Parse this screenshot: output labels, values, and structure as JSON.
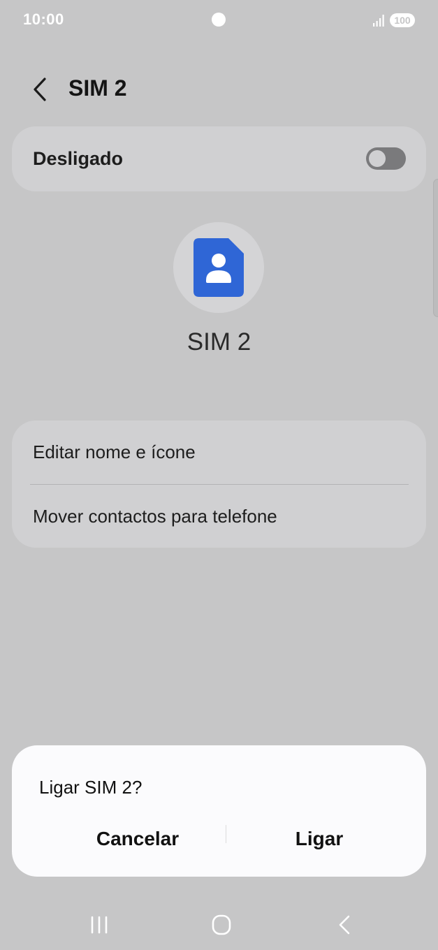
{
  "status_bar": {
    "time": "10:00",
    "battery": "100",
    "signal_icon": "signal-bars-icon",
    "camera_icon": "camera-cutout"
  },
  "header": {
    "title": "SIM 2",
    "back_icon": "chevron-left-icon"
  },
  "toggle": {
    "label": "Desligado",
    "state": "off"
  },
  "sim": {
    "name": "SIM 2",
    "icon": "sim-card-person-icon",
    "icon_color": "#2f66d6"
  },
  "options": [
    {
      "label": "Editar nome e ícone"
    },
    {
      "label": "Mover contactos para telefone"
    }
  ],
  "dialog": {
    "title": "Ligar SIM 2?",
    "cancel_label": "Cancelar",
    "confirm_label": "Ligar"
  },
  "nav_bar": {
    "recents_icon": "recents-icon",
    "home_icon": "home-icon",
    "back_icon": "back-icon"
  },
  "colors": {
    "background": "#c6c6c7",
    "card": "#d0d0d2",
    "dialog": "#fbfbfd",
    "accent": "#2f66d6"
  }
}
